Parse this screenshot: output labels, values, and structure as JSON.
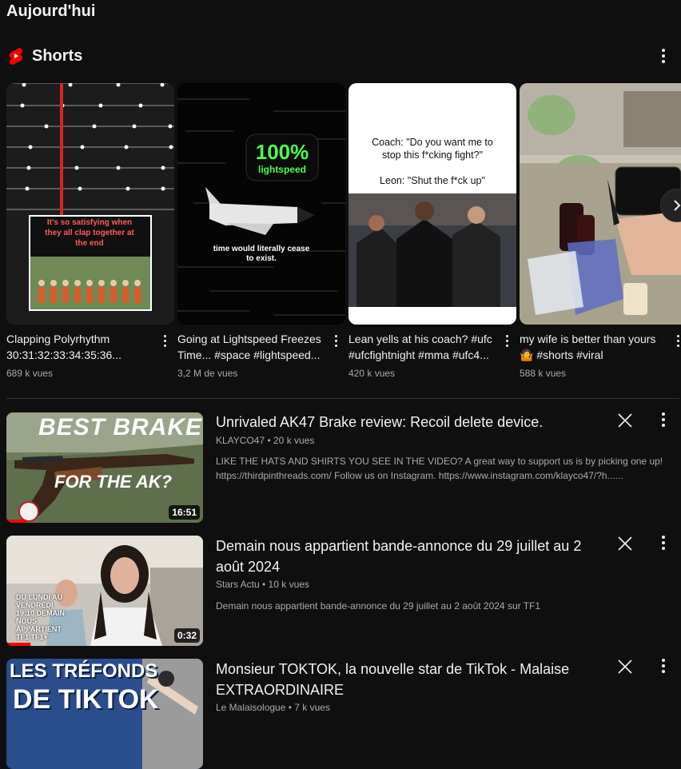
{
  "section": {
    "title": "Aujourd'hui"
  },
  "shorts": {
    "label": "Shorts",
    "items": [
      {
        "title": "Clapping Polyrhythm 30:31:32:33:34:35:36...",
        "views": "689 k vues",
        "overlay_text": "It's so satisfying when they all clap together at the end"
      },
      {
        "title": "Going at Lightspeed Freezes Time... #space #lightspeed...",
        "views": "3,2 M de vues",
        "overlay_badge": "100%",
        "overlay_sub": "lightspeed",
        "overlay_caption": "time would literally cease to exist."
      },
      {
        "title": "Lean yells at his coach? #ufc #ufcfightnight #mma #ufc4...",
        "views": "420 k vues",
        "overlay_text": "Coach: \"Do you want me to stop this f*cking fight?\"\n\nLeon: \"Shut the f*ck up\""
      },
      {
        "title": "my wife is better than yours 🤷 #shorts #viral",
        "views": "588 k vues"
      }
    ]
  },
  "videos": [
    {
      "title": "Unrivaled AK47 Brake review: Recoil delete device.",
      "meta": "KLAYCO47 • 20 k vues",
      "description": "LIKE THE HATS AND SHIRTS YOU SEE IN THE VIDEO? A great way to support us is by picking one up! https://thirdpinthreads.com/ Follow us on Instagram. https://www.instagram.com/klayco47/?h......",
      "duration": "16:51",
      "progress": 0.1,
      "thumb_text_top": "BEST BRAKE",
      "thumb_text_bottom": "FOR THE AK?"
    },
    {
      "title": "Demain nous appartient bande-annonce du 29 juillet au 2 août 2024",
      "meta": "Stars Actu • 10 k vues",
      "description": "Demain nous appartient bande-annonce du 29 juillet au 2 août 2024 sur TF1",
      "duration": "0:32",
      "progress": 0.12,
      "thumb_text": "DU LUNDI AU VENDREDI 19:10 DEMAIN NOUS APPARTIENT TF1 TF1+"
    },
    {
      "title": "Monsieur TOKTOK, la nouvelle star de TikTok - Malaise EXTRAORDINAIRE",
      "meta": "Le Malaisologue • 7 k vues",
      "thumb_text_top": "LES TRÉFONDS",
      "thumb_text_bottom": "DE TIKTOK"
    }
  ],
  "colors": {
    "background": "#0f0f0f",
    "accent": "#ff0000",
    "text": "#f1f1f1",
    "muted": "#aaaaaa"
  }
}
